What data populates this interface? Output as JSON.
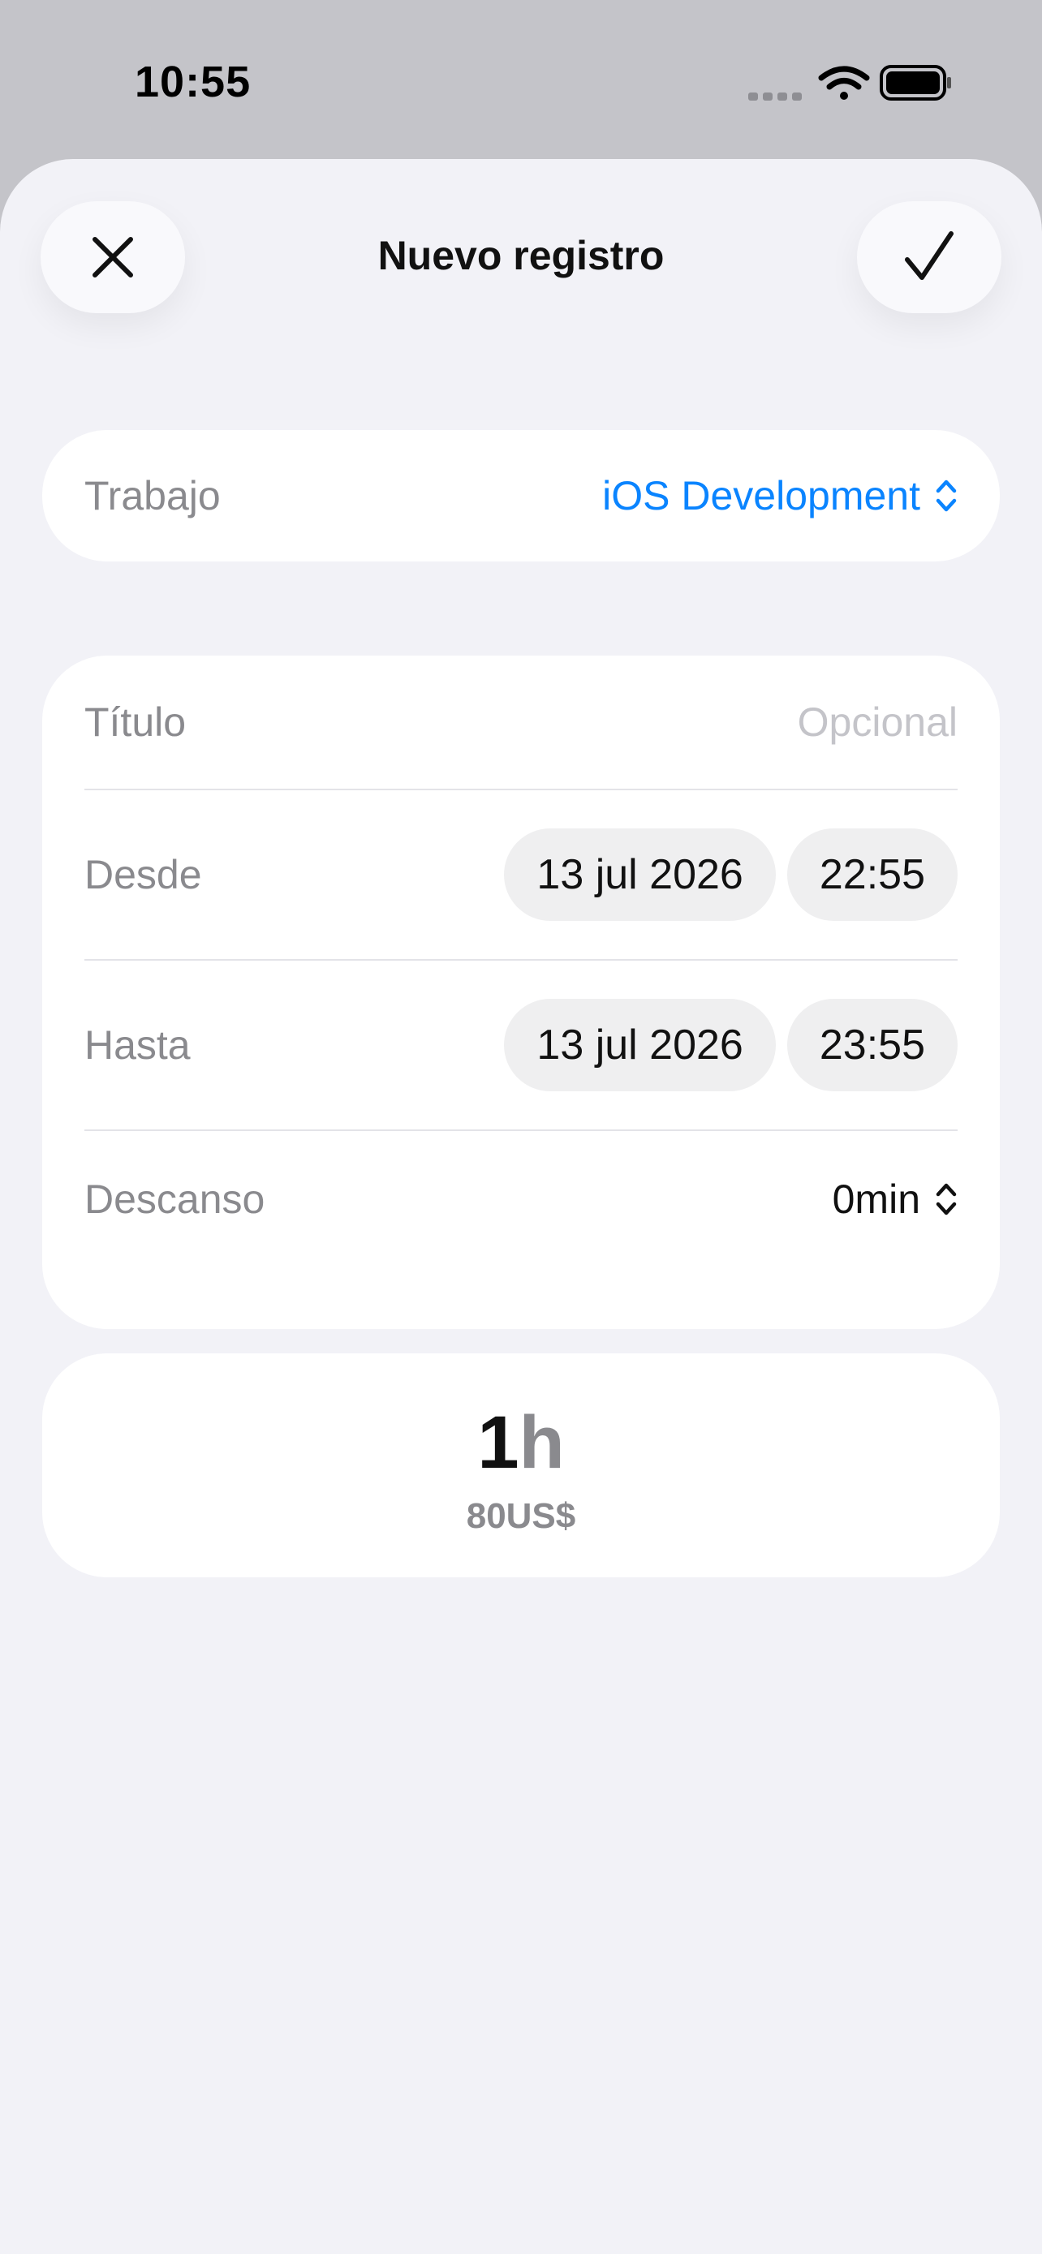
{
  "status_bar": {
    "time": "10:55",
    "icons": [
      "signal-dots-icon",
      "wifi-icon",
      "battery-icon"
    ]
  },
  "header": {
    "title": "Nuevo registro",
    "close_icon": "close-icon",
    "done_icon": "checkmark-icon"
  },
  "job": {
    "label": "Trabajo",
    "value": "iOS Development",
    "icon": "chevron-up-down-icon"
  },
  "form": {
    "title_label": "Título",
    "title_placeholder": "Opcional",
    "from_label": "Desde",
    "from_date": "13 jul 2026",
    "from_time": "22:55",
    "to_label": "Hasta",
    "to_date": "13 jul 2026",
    "to_time": "23:55",
    "break_label": "Descanso",
    "break_value": "0min"
  },
  "summary": {
    "hours_value": "1",
    "hours_unit": "h",
    "earnings": "80US$"
  },
  "colors": {
    "accent": "#0a84ff",
    "background": "#f2f2f7",
    "card": "#ffffff",
    "secondary_text": "#8a8a8e",
    "placeholder": "#c4c4c9"
  }
}
